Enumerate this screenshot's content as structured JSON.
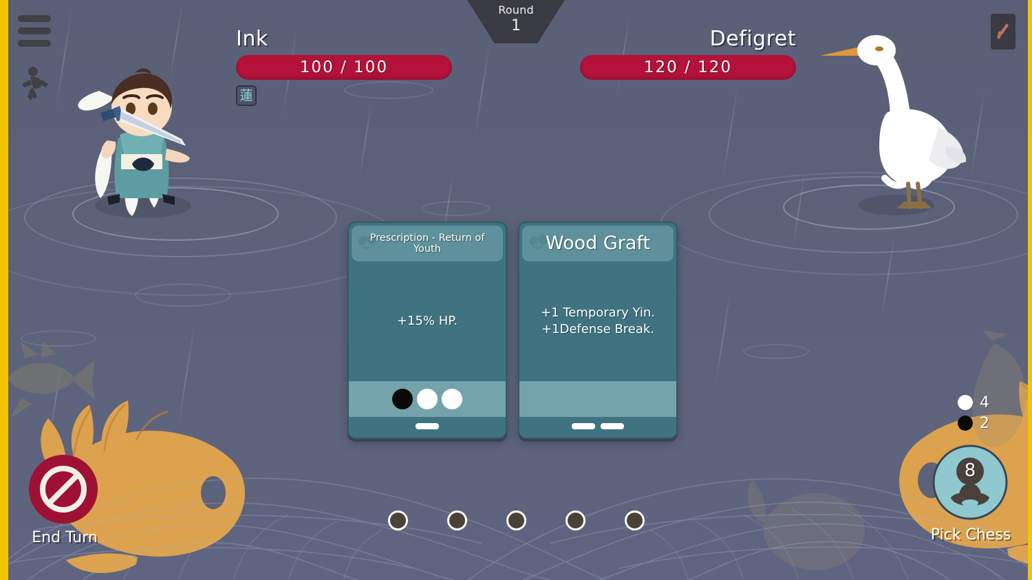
{
  "theme": {
    "background": "#5c6279",
    "accent_yellow": "#f2c300",
    "hp_red": "#b4123b",
    "card_teal": "#3f7380",
    "card_header_teal": "#5e919b",
    "card_cost_teal": "#74a3ab",
    "koi_gold": "#dda24e",
    "pick_chess_teal": "#8fc8cf"
  },
  "round": {
    "label": "Round",
    "value": "1"
  },
  "player": {
    "name": "Ink",
    "hp_current": 100,
    "hp_max": 100,
    "hp_text": "100 / 100",
    "buffs": [
      {
        "name": "lotus-buff",
        "glyph": "蓮"
      }
    ]
  },
  "enemy": {
    "name": "Defigret",
    "hp_current": 120,
    "hp_max": 120,
    "hp_text": "120 / 120"
  },
  "left_toolbar": {
    "menu_icon": "hamburger-menu-icon",
    "flee_icon": "running-figure-icon"
  },
  "right_toolbar": {
    "card_icon": "sword-card-icon"
  },
  "cards": [
    {
      "title": "Prescription - Return of Youth",
      "title_size": "small",
      "body": "+15% HP.",
      "stones": [
        "black",
        "white",
        "white"
      ],
      "dashes": 1,
      "deco_icon": "mushroom-deco-icon"
    },
    {
      "title": "Wood Graft",
      "title_size": "large",
      "body_lines": [
        "+1 Temporary Yin.",
        "+1Defense Break."
      ],
      "stones": [],
      "dashes": 2,
      "deco_icon": "mushroom-deco-icon"
    }
  ],
  "hand_slots": {
    "count": 5,
    "filled": 0
  },
  "end_turn": {
    "label": "End Turn",
    "icon": "no-entry-icon"
  },
  "pick_chess": {
    "label": "Pick Chess",
    "value": "8",
    "icon": "meditating-figure-icon"
  },
  "stone_counters": [
    {
      "color": "white",
      "count": "4"
    },
    {
      "color": "black",
      "count": "2"
    }
  ],
  "scene": {
    "player_sprite": "chibi-swordswoman-sprite",
    "enemy_sprite": "white-egret-sprite",
    "background_decor": [
      "koi-fish-left",
      "koi-fish-right",
      "water-ripples",
      "rain-streaks",
      "net-pattern"
    ]
  }
}
